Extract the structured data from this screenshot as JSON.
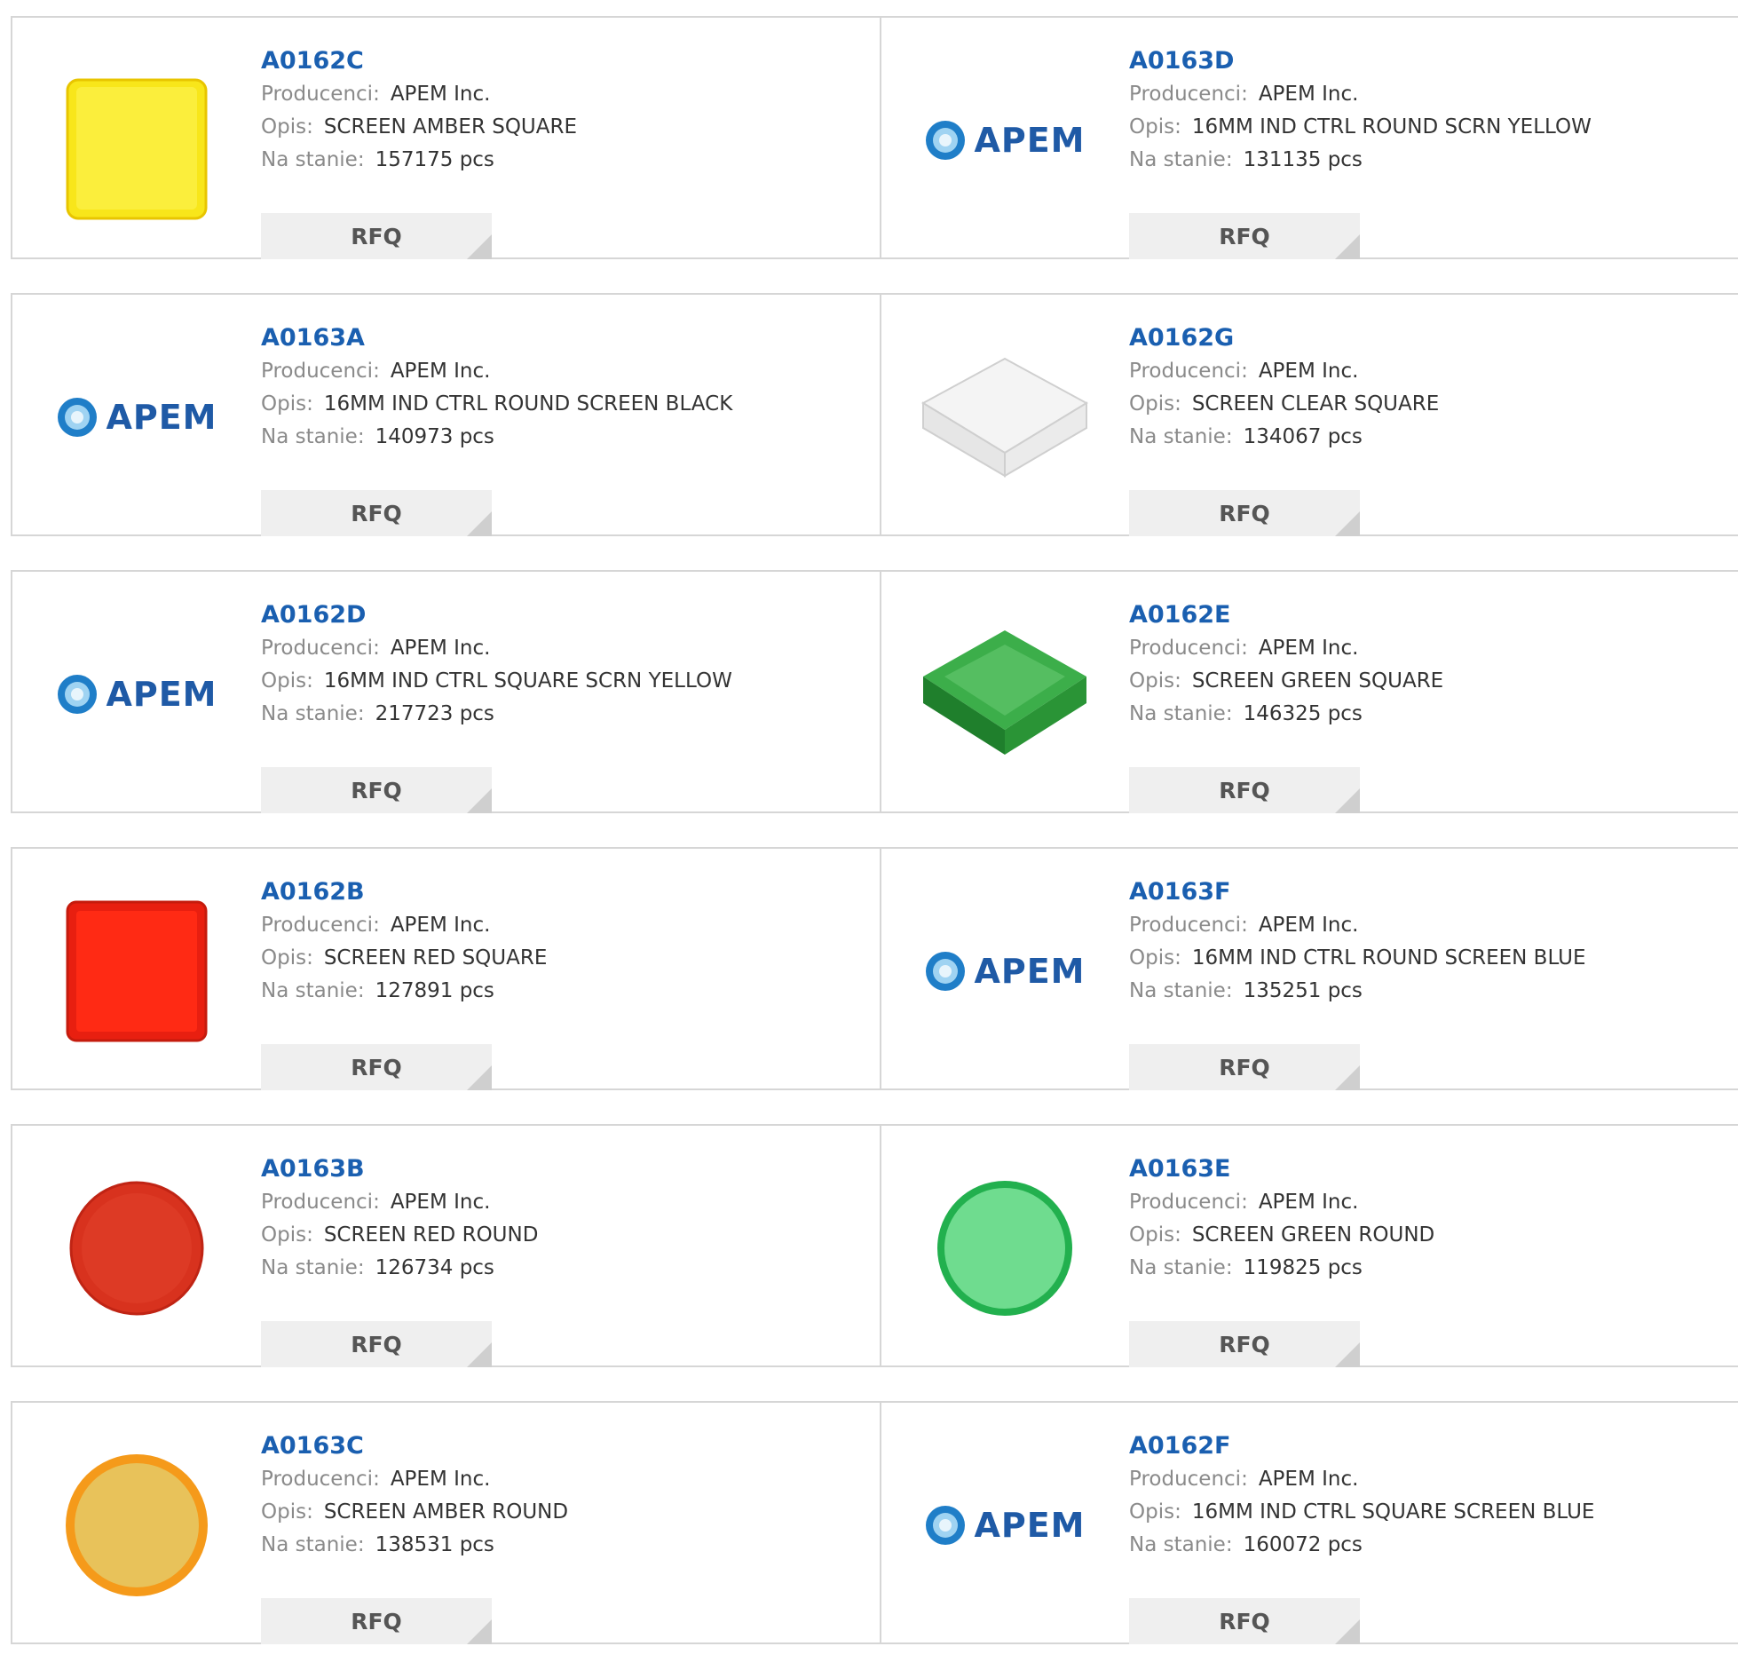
{
  "labels": {
    "manufacturer": "Producenci:",
    "description": "Opis:",
    "stock": "Na stanie:",
    "rfq": "RFQ"
  },
  "brand": {
    "logo_text": "APEM",
    "logo_color": "#1f5aa6"
  },
  "products": [
    {
      "part": "A0162C",
      "manufacturer": "APEM Inc.",
      "description": "SCREEN AMBER SQUARE",
      "stock": "157175 pcs",
      "image": "yellow-square-screen"
    },
    {
      "part": "A0163D",
      "manufacturer": "APEM Inc.",
      "description": "16MM IND CTRL ROUND SCRN YELLOW",
      "stock": "131135 pcs",
      "image": "apem-logo"
    },
    {
      "part": "A0163A",
      "manufacturer": "APEM Inc.",
      "description": "16MM IND CTRL ROUND SCREEN BLACK",
      "stock": "140973 pcs",
      "image": "apem-logo"
    },
    {
      "part": "A0162G",
      "manufacturer": "APEM Inc.",
      "description": "SCREEN CLEAR SQUARE",
      "stock": "134067 pcs",
      "image": "clear-square-screen"
    },
    {
      "part": "A0162D",
      "manufacturer": "APEM Inc.",
      "description": "16MM IND CTRL SQUARE SCRN YELLOW",
      "stock": "217723 pcs",
      "image": "apem-logo"
    },
    {
      "part": "A0162E",
      "manufacturer": "APEM Inc.",
      "description": "SCREEN GREEN SQUARE",
      "stock": "146325 pcs",
      "image": "green-square-screen"
    },
    {
      "part": "A0162B",
      "manufacturer": "APEM Inc.",
      "description": "SCREEN RED SQUARE",
      "stock": "127891 pcs",
      "image": "red-square-screen"
    },
    {
      "part": "A0163F",
      "manufacturer": "APEM Inc.",
      "description": "16MM IND CTRL ROUND SCREEN BLUE",
      "stock": "135251 pcs",
      "image": "apem-logo"
    },
    {
      "part": "A0163B",
      "manufacturer": "APEM Inc.",
      "description": "SCREEN RED ROUND",
      "stock": "126734 pcs",
      "image": "red-round-screen"
    },
    {
      "part": "A0163E",
      "manufacturer": "APEM Inc.",
      "description": "SCREEN GREEN ROUND",
      "stock": "119825 pcs",
      "image": "green-round-screen"
    },
    {
      "part": "A0163C",
      "manufacturer": "APEM Inc.",
      "description": "SCREEN AMBER ROUND",
      "stock": "138531 pcs",
      "image": "amber-round-screen"
    },
    {
      "part": "A0162F",
      "manufacturer": "APEM Inc.",
      "description": "16MM IND CTRL SQUARE SCREEN BLUE",
      "stock": "160072 pcs",
      "image": "apem-logo"
    }
  ],
  "colors": {
    "part_link": "#1a5fb0",
    "label": "#8a8a8a",
    "value": "#333333",
    "rfq_bg": "#efefef",
    "border": "#d6d6d6"
  }
}
